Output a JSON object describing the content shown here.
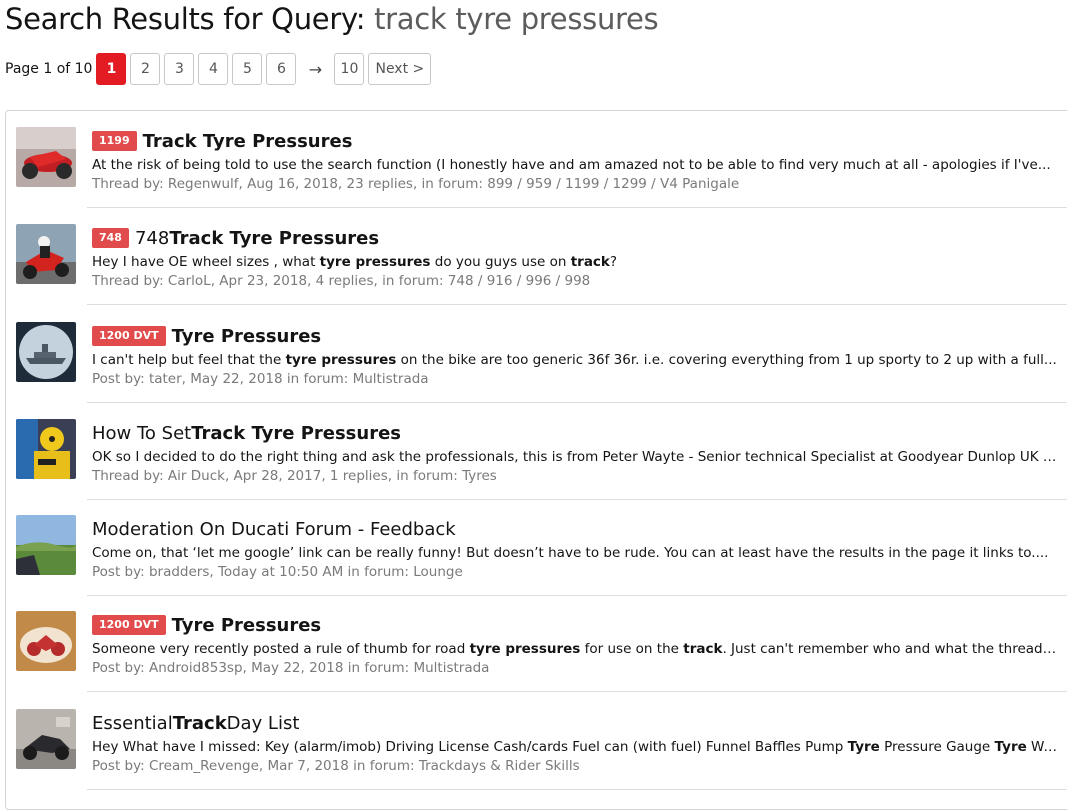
{
  "header": {
    "title_prefix": "Search Results for Query:",
    "query": "track tyre pressures"
  },
  "pagination": {
    "info": "Page 1 of 10",
    "pages": [
      "1",
      "2",
      "3",
      "4",
      "5",
      "6"
    ],
    "current": "1",
    "arrow": "→",
    "last": "10",
    "next": "Next >"
  },
  "results": [
    {
      "badge": "1199",
      "title": [
        {
          "t": "Track Tyre Pressures",
          "b": true
        }
      ],
      "snippet": [
        {
          "t": "At the risk of being told to use the search function (I honestly have and am amazed not to be able to find very much at all - apologies if I've...",
          "b": false
        }
      ],
      "meta_prefix": "Thread by:",
      "author": "Regenwulf",
      "date": "Aug 16, 2018",
      "replies": "23 replies,",
      "forum_prefix": "in forum:",
      "forum": "899 / 959 / 1199 / 1299 / V4 Panigale",
      "thumb": "red-sportbike-icon"
    },
    {
      "badge": "748",
      "title": [
        {
          "t": "748 ",
          "b": false
        },
        {
          "t": "Track Tyre Pressures",
          "b": true
        }
      ],
      "snippet": [
        {
          "t": "Hey I have OE wheel sizes , what ",
          "b": false
        },
        {
          "t": "tyre pressures",
          "b": true
        },
        {
          "t": " do you guys use on ",
          "b": false
        },
        {
          "t": "track",
          "b": true
        },
        {
          "t": "?",
          "b": false
        }
      ],
      "meta_prefix": "Thread by:",
      "author": "CarloL",
      "date": "Apr 23, 2018",
      "replies": "4 replies,",
      "forum_prefix": "in forum:",
      "forum": "748 / 916 / 996 / 998",
      "thumb": "rider-on-red-bike-icon"
    },
    {
      "badge": "1200 DVT",
      "title": [
        {
          "t": "Tyre Pressures",
          "b": true
        }
      ],
      "snippet": [
        {
          "t": "I can't help but feel that the ",
          "b": false
        },
        {
          "t": "tyre pressures",
          "b": true
        },
        {
          "t": " on the bike are too generic 36f 36r. i.e. covering everything from 1 up sporty to 2 up with a full...",
          "b": false
        }
      ],
      "meta_prefix": "Post by:",
      "author": "tater",
      "date": "May 22, 2018",
      "replies": "",
      "forum_prefix": "in forum:",
      "forum": "Multistrada",
      "thumb": "warship-periscope-icon"
    },
    {
      "badge": "",
      "title": [
        {
          "t": "How To Set ",
          "b": false
        },
        {
          "t": "Track Tyre Pressures",
          "b": true
        }
      ],
      "snippet": [
        {
          "t": "OK so I decided to do the right thing and ask the professionals, this is from Peter Wayte - Senior technical Specialist at Goodyear Dunlop UK (who...",
          "b": false
        }
      ],
      "meta_prefix": "Thread by:",
      "author": "Air Duck",
      "date": "Apr 28, 2017",
      "replies": "1 replies,",
      "forum_prefix": "in forum:",
      "forum": "Tyres",
      "thumb": "crash-test-dummy-icon"
    },
    {
      "badge": "",
      "title": [
        {
          "t": "Moderation On Ducati Forum - Feedback",
          "b": false
        }
      ],
      "snippet": [
        {
          "t": "Come on, that ‘let me google’ link can be really funny! But doesn’t have to be rude. You can at least have the results in the page it links to....",
          "b": false
        }
      ],
      "meta_prefix": "Post by:",
      "author": "bradders",
      "date": "Today at 10:50 AM",
      "replies": "",
      "forum_prefix": "in forum:",
      "forum": "Lounge",
      "thumb": "landscape-icon"
    },
    {
      "badge": "1200 DVT",
      "title": [
        {
          "t": "Tyre Pressures",
          "b": true
        }
      ],
      "snippet": [
        {
          "t": "Someone very recently posted a rule of thumb for road ",
          "b": false
        },
        {
          "t": "tyre pressures",
          "b": true
        },
        {
          "t": " for use on the ",
          "b": false
        },
        {
          "t": "track",
          "b": true
        },
        {
          "t": ". Just can't remember who and what the thread was...",
          "b": false
        }
      ],
      "meta_prefix": "Post by:",
      "author": "Android853sp",
      "date": "May 22, 2018",
      "replies": "",
      "forum_prefix": "in forum:",
      "forum": "Multistrada",
      "thumb": "motorbike-cake-icon"
    },
    {
      "badge": "",
      "title": [
        {
          "t": "Essential ",
          "b": false
        },
        {
          "t": "Track",
          "b": true
        },
        {
          "t": " Day List",
          "b": false
        }
      ],
      "snippet": [
        {
          "t": "Hey What have I missed: Key (alarm/imob) Driving License Cash/cards Fuel can (with fuel) Funnel Baffles Pump ",
          "b": false
        },
        {
          "t": "Tyre",
          "b": true
        },
        {
          "t": " Pressure Gauge ",
          "b": false
        },
        {
          "t": "Tyre",
          "b": true
        },
        {
          "t": " Warmers...",
          "b": false
        }
      ],
      "meta_prefix": "Post by:",
      "author": "Cream_Revenge",
      "date": "Mar 7, 2018",
      "replies": "",
      "forum_prefix": "in forum:",
      "forum": "Trackdays & Rider Skills",
      "thumb": "garage-motorbike-icon"
    }
  ]
}
